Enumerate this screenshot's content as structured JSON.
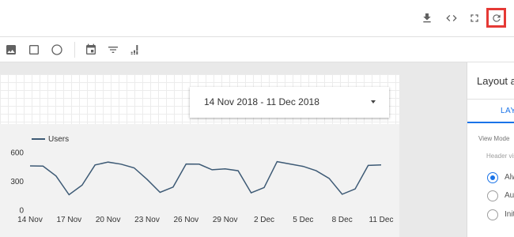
{
  "toolbar": {
    "icons": [
      "download-icon",
      "embed-code-icon",
      "fullscreen-icon",
      "refresh-icon"
    ],
    "highlight_color": "#e53935"
  },
  "insert_toolbar": {
    "icons": [
      "image-icon",
      "rectangle-icon",
      "circle-icon",
      "date-range-icon",
      "filter-icon",
      "data-control-icon"
    ]
  },
  "date_range": {
    "value": "14 Nov 2018 - 11 Dec 2018"
  },
  "right_panel": {
    "title": "Layout a",
    "tab_label": "LAYO",
    "view_mode_label": "View Mode",
    "header_visibility_label": "Header visi",
    "options": [
      {
        "label": "Alw",
        "selected": true
      },
      {
        "label": "Aut",
        "selected": false
      },
      {
        "label": "Init",
        "selected": false
      }
    ],
    "accent_color": "#1a73e8"
  },
  "chart_data": {
    "type": "line",
    "series": [
      {
        "name": "Users",
        "color": "#3d5a75",
        "values": [
          460,
          458,
          355,
          160,
          260,
          470,
          500,
          478,
          440,
          320,
          185,
          240,
          480,
          478,
          420,
          430,
          410,
          180,
          235,
          505,
          480,
          455,
          410,
          330,
          165,
          220,
          465,
          470
        ]
      }
    ],
    "x_tick_labels": [
      "14 Nov",
      "17 Nov",
      "20 Nov",
      "23 Nov",
      "26 Nov",
      "29 Nov",
      "2 Dec",
      "5 Dec",
      "8 Dec",
      "11 Dec"
    ],
    "y_ticks": [
      0,
      300,
      600
    ],
    "ylim": [
      0,
      600
    ],
    "legend_position": "top-left",
    "grid": false
  }
}
